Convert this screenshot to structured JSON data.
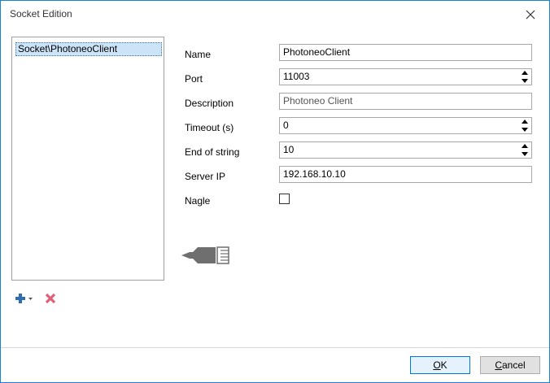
{
  "window": {
    "title": "Socket Edition"
  },
  "socket_list": {
    "items": [
      "Socket\\PhotoneoClient"
    ]
  },
  "form": {
    "name_label": "Name",
    "name_value": "PhotoneoClient",
    "port_label": "Port",
    "port_value": "11003",
    "description_label": "Description",
    "description_value": "Photoneo Client",
    "timeout_label": "Timeout (s)",
    "timeout_value": "0",
    "end_of_string_label": "End of string",
    "end_of_string_value": "10",
    "server_ip_label": "Server IP",
    "server_ip_value": "192.168.10.10",
    "nagle_label": "Nagle",
    "nagle_checked": false
  },
  "toolbar": {
    "add_icon": "plus-dropdown-icon",
    "remove_icon": "red-x-icon"
  },
  "buttons": {
    "ok_access": "O",
    "ok_rest": "K",
    "cancel_access": "C",
    "cancel_rest": "ancel"
  },
  "colors": {
    "window_border": "#1883d7",
    "selection": "#cce4f7",
    "ok_border": "#0078d7",
    "add_icon": "#2f6db5",
    "remove_icon": "#e0607a"
  }
}
